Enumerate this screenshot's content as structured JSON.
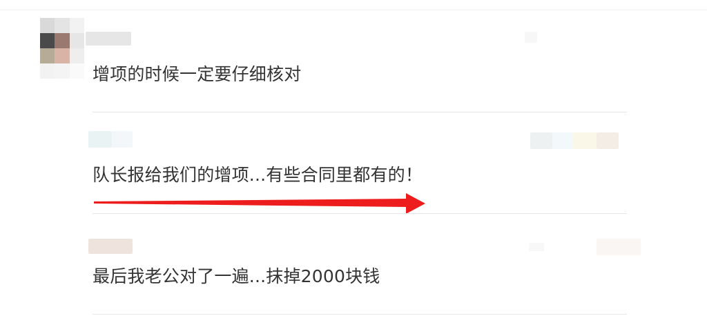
{
  "comments": [
    {
      "text": "增项的时候一定要仔细核对"
    },
    {
      "text": "队长报给我们的增项...有些合同里都有的！"
    },
    {
      "text": "最后我老公对了一遍...抹掉2000块钱"
    }
  ],
  "colors": {
    "text": "#333333",
    "divider": "#e6e6e6",
    "arrow": "#ee1d1d"
  },
  "icons": {
    "arrow": "red-arrow-right",
    "avatar": "pixelated-avatar"
  }
}
